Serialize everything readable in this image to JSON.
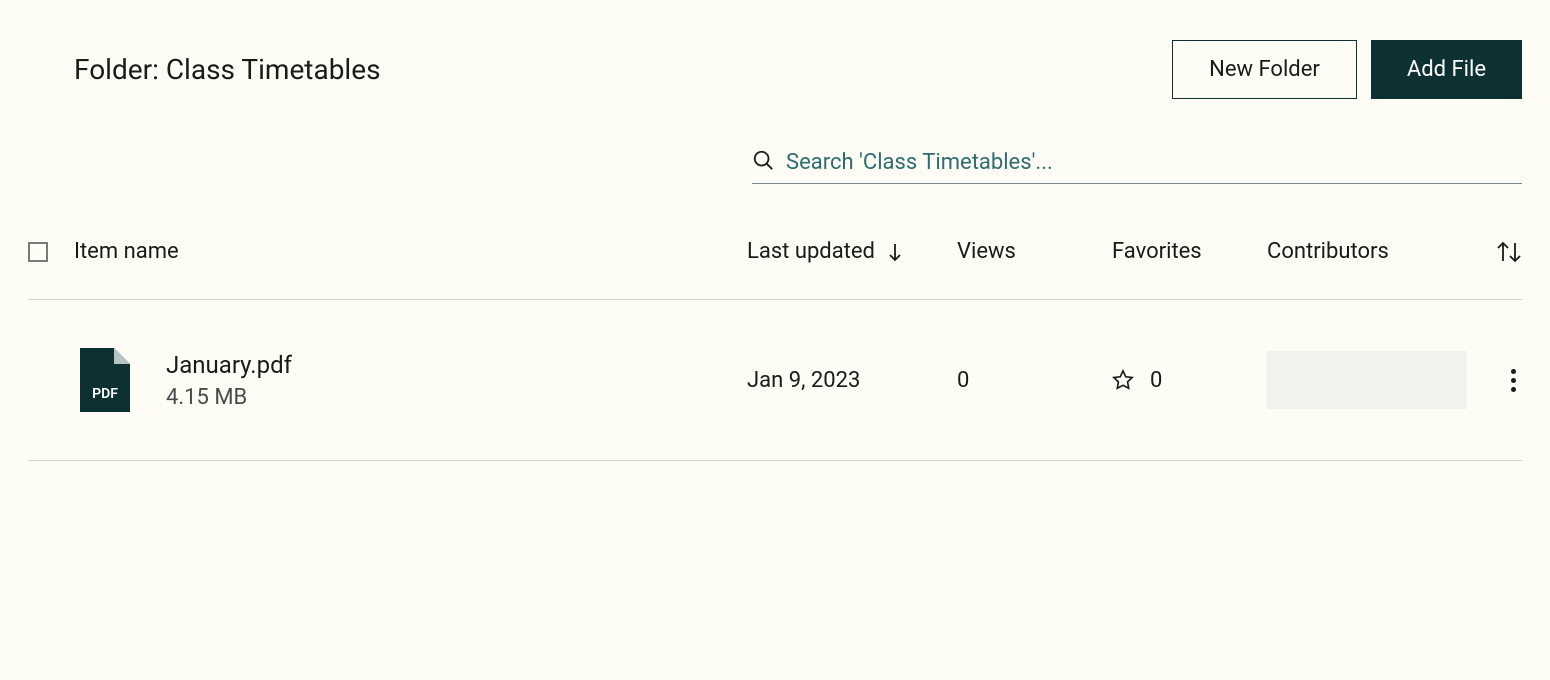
{
  "header": {
    "title": "Folder: Class Timetables",
    "new_folder_label": "New Folder",
    "add_file_label": "Add File"
  },
  "search": {
    "placeholder": "Search 'Class Timetables'..."
  },
  "columns": {
    "item_name": "Item name",
    "last_updated": "Last updated",
    "views": "Views",
    "favorites": "Favorites",
    "contributors": "Contributors"
  },
  "rows": [
    {
      "file_type": "PDF",
      "name": "January.pdf",
      "size": "4.15 MB",
      "last_updated": "Jan 9, 2023",
      "views": "0",
      "favorites": "0"
    }
  ]
}
